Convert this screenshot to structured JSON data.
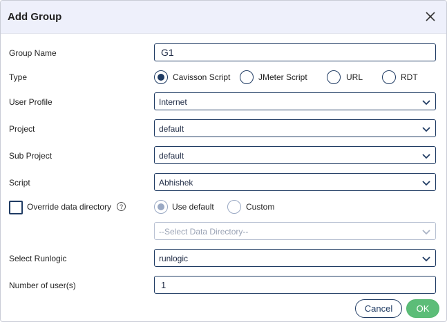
{
  "dialog": {
    "title": "Add Group"
  },
  "form": {
    "group_name": {
      "label": "Group Name",
      "value": "G1"
    },
    "type": {
      "label": "Type",
      "options": [
        "Cavisson Script",
        "JMeter Script",
        "URL",
        "RDT"
      ],
      "selected": "Cavisson Script"
    },
    "user_profile": {
      "label": "User Profile",
      "value": "Internet"
    },
    "project": {
      "label": "Project",
      "value": "default"
    },
    "sub_project": {
      "label": "Sub Project",
      "value": "default"
    },
    "script": {
      "label": "Script",
      "value": "Abhishek"
    },
    "override": {
      "label": "Override data directory",
      "checked": false,
      "help": "?",
      "options": [
        "Use default",
        "Custom"
      ],
      "selected": "Use default"
    },
    "data_directory": {
      "placeholder": "--Select Data Directory--"
    },
    "runlogic": {
      "label": "Select Runlogic",
      "value": "runlogic"
    },
    "num_users": {
      "label": "Number of user(s)",
      "value": "1"
    }
  },
  "buttons": {
    "cancel": "Cancel",
    "ok": "OK"
  },
  "colors": {
    "accent": "#1f3b63",
    "ok_green": "#5cbd78",
    "header_bg": "#eef0fb"
  }
}
